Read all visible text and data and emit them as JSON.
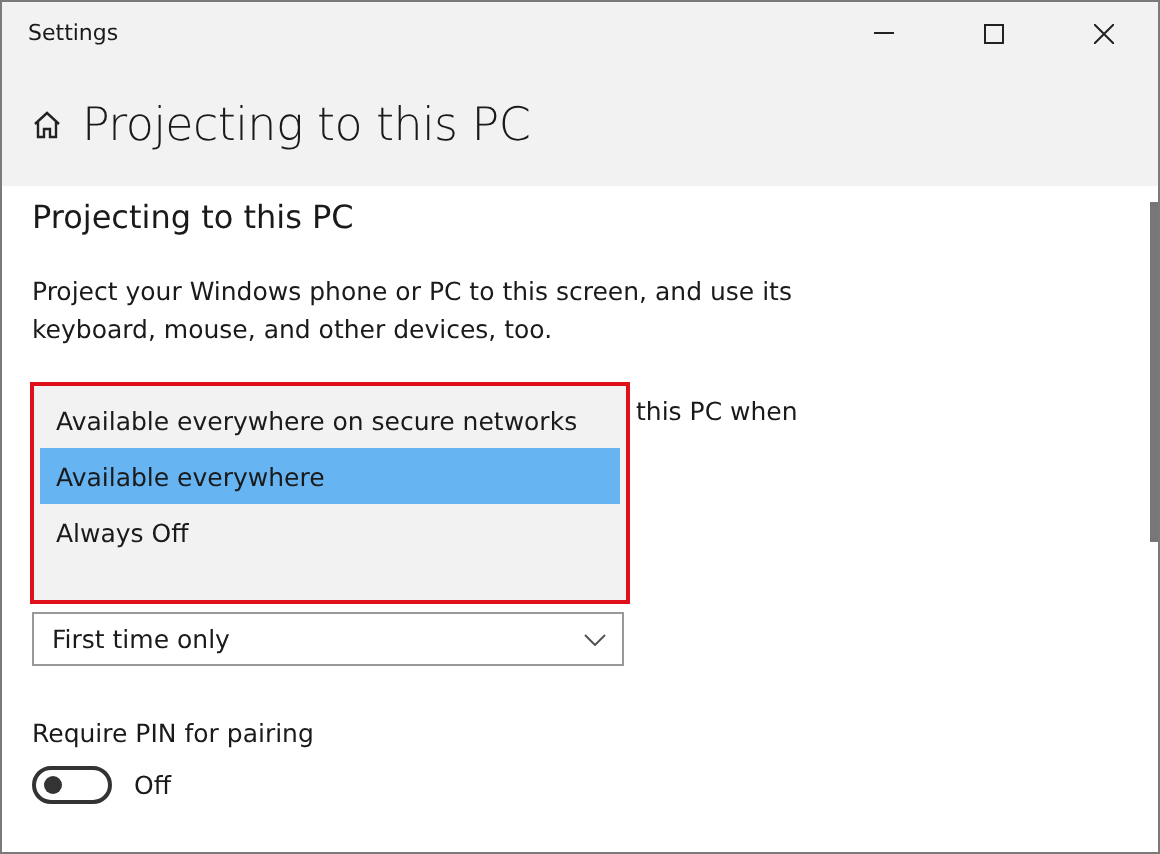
{
  "window": {
    "title": "Settings"
  },
  "header": {
    "title": "Projecting to this PC"
  },
  "section": {
    "title": "Projecting to this PC",
    "description": "Project your Windows phone or PC to this screen, and use its keyboard, mouse, and other devices, too."
  },
  "availability_label_fragment": "this PC when",
  "availability_menu": {
    "options": [
      {
        "label": "Available everywhere on secure networks",
        "selected": false
      },
      {
        "label": "Available everywhere",
        "selected": true
      },
      {
        "label": "Always Off",
        "selected": false
      }
    ]
  },
  "ask_to_project": {
    "value": "First time only"
  },
  "require_pin": {
    "label": "Require PIN for pairing",
    "on": false,
    "state_text": "Off"
  }
}
